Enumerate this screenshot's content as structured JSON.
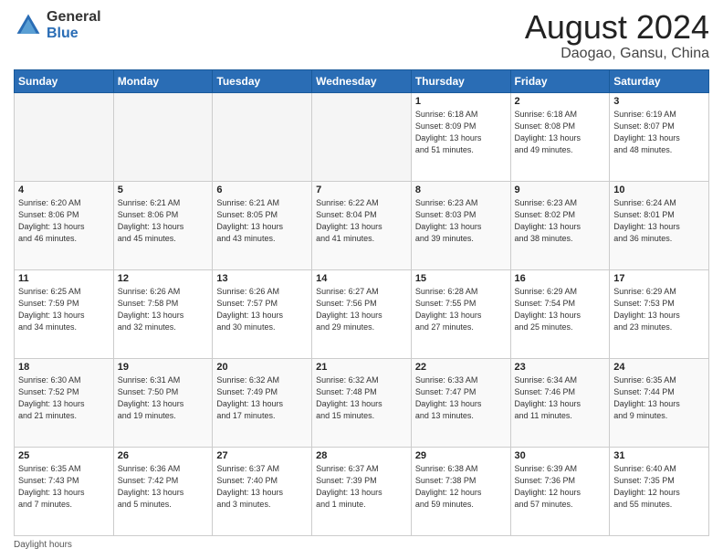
{
  "header": {
    "logo_line1": "General",
    "logo_line2": "Blue",
    "main_title": "August 2024",
    "sub_title": "Daogao, Gansu, China"
  },
  "days_of_week": [
    "Sunday",
    "Monday",
    "Tuesday",
    "Wednesday",
    "Thursday",
    "Friday",
    "Saturday"
  ],
  "weeks": [
    [
      {
        "day": "",
        "info": ""
      },
      {
        "day": "",
        "info": ""
      },
      {
        "day": "",
        "info": ""
      },
      {
        "day": "",
        "info": ""
      },
      {
        "day": "1",
        "info": "Sunrise: 6:18 AM\nSunset: 8:09 PM\nDaylight: 13 hours\nand 51 minutes."
      },
      {
        "day": "2",
        "info": "Sunrise: 6:18 AM\nSunset: 8:08 PM\nDaylight: 13 hours\nand 49 minutes."
      },
      {
        "day": "3",
        "info": "Sunrise: 6:19 AM\nSunset: 8:07 PM\nDaylight: 13 hours\nand 48 minutes."
      }
    ],
    [
      {
        "day": "4",
        "info": "Sunrise: 6:20 AM\nSunset: 8:06 PM\nDaylight: 13 hours\nand 46 minutes."
      },
      {
        "day": "5",
        "info": "Sunrise: 6:21 AM\nSunset: 8:06 PM\nDaylight: 13 hours\nand 45 minutes."
      },
      {
        "day": "6",
        "info": "Sunrise: 6:21 AM\nSunset: 8:05 PM\nDaylight: 13 hours\nand 43 minutes."
      },
      {
        "day": "7",
        "info": "Sunrise: 6:22 AM\nSunset: 8:04 PM\nDaylight: 13 hours\nand 41 minutes."
      },
      {
        "day": "8",
        "info": "Sunrise: 6:23 AM\nSunset: 8:03 PM\nDaylight: 13 hours\nand 39 minutes."
      },
      {
        "day": "9",
        "info": "Sunrise: 6:23 AM\nSunset: 8:02 PM\nDaylight: 13 hours\nand 38 minutes."
      },
      {
        "day": "10",
        "info": "Sunrise: 6:24 AM\nSunset: 8:01 PM\nDaylight: 13 hours\nand 36 minutes."
      }
    ],
    [
      {
        "day": "11",
        "info": "Sunrise: 6:25 AM\nSunset: 7:59 PM\nDaylight: 13 hours\nand 34 minutes."
      },
      {
        "day": "12",
        "info": "Sunrise: 6:26 AM\nSunset: 7:58 PM\nDaylight: 13 hours\nand 32 minutes."
      },
      {
        "day": "13",
        "info": "Sunrise: 6:26 AM\nSunset: 7:57 PM\nDaylight: 13 hours\nand 30 minutes."
      },
      {
        "day": "14",
        "info": "Sunrise: 6:27 AM\nSunset: 7:56 PM\nDaylight: 13 hours\nand 29 minutes."
      },
      {
        "day": "15",
        "info": "Sunrise: 6:28 AM\nSunset: 7:55 PM\nDaylight: 13 hours\nand 27 minutes."
      },
      {
        "day": "16",
        "info": "Sunrise: 6:29 AM\nSunset: 7:54 PM\nDaylight: 13 hours\nand 25 minutes."
      },
      {
        "day": "17",
        "info": "Sunrise: 6:29 AM\nSunset: 7:53 PM\nDaylight: 13 hours\nand 23 minutes."
      }
    ],
    [
      {
        "day": "18",
        "info": "Sunrise: 6:30 AM\nSunset: 7:52 PM\nDaylight: 13 hours\nand 21 minutes."
      },
      {
        "day": "19",
        "info": "Sunrise: 6:31 AM\nSunset: 7:50 PM\nDaylight: 13 hours\nand 19 minutes."
      },
      {
        "day": "20",
        "info": "Sunrise: 6:32 AM\nSunset: 7:49 PM\nDaylight: 13 hours\nand 17 minutes."
      },
      {
        "day": "21",
        "info": "Sunrise: 6:32 AM\nSunset: 7:48 PM\nDaylight: 13 hours\nand 15 minutes."
      },
      {
        "day": "22",
        "info": "Sunrise: 6:33 AM\nSunset: 7:47 PM\nDaylight: 13 hours\nand 13 minutes."
      },
      {
        "day": "23",
        "info": "Sunrise: 6:34 AM\nSunset: 7:46 PM\nDaylight: 13 hours\nand 11 minutes."
      },
      {
        "day": "24",
        "info": "Sunrise: 6:35 AM\nSunset: 7:44 PM\nDaylight: 13 hours\nand 9 minutes."
      }
    ],
    [
      {
        "day": "25",
        "info": "Sunrise: 6:35 AM\nSunset: 7:43 PM\nDaylight: 13 hours\nand 7 minutes."
      },
      {
        "day": "26",
        "info": "Sunrise: 6:36 AM\nSunset: 7:42 PM\nDaylight: 13 hours\nand 5 minutes."
      },
      {
        "day": "27",
        "info": "Sunrise: 6:37 AM\nSunset: 7:40 PM\nDaylight: 13 hours\nand 3 minutes."
      },
      {
        "day": "28",
        "info": "Sunrise: 6:37 AM\nSunset: 7:39 PM\nDaylight: 13 hours\nand 1 minute."
      },
      {
        "day": "29",
        "info": "Sunrise: 6:38 AM\nSunset: 7:38 PM\nDaylight: 12 hours\nand 59 minutes."
      },
      {
        "day": "30",
        "info": "Sunrise: 6:39 AM\nSunset: 7:36 PM\nDaylight: 12 hours\nand 57 minutes."
      },
      {
        "day": "31",
        "info": "Sunrise: 6:40 AM\nSunset: 7:35 PM\nDaylight: 12 hours\nand 55 minutes."
      }
    ]
  ],
  "footer": {
    "daylight_hours_label": "Daylight hours"
  }
}
